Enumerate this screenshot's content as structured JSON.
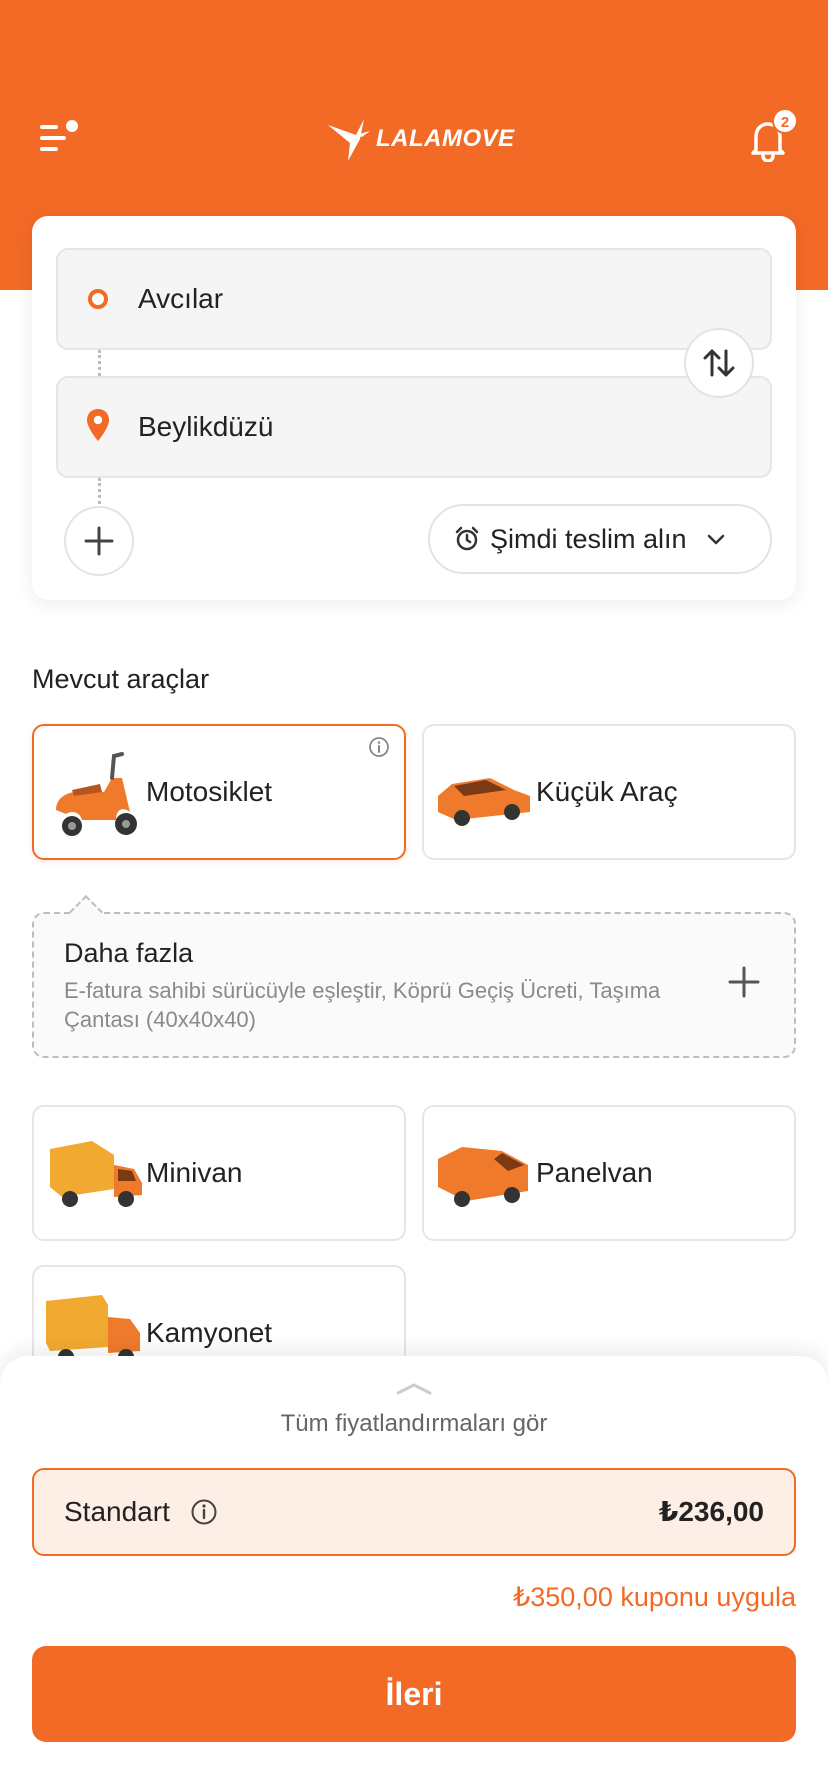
{
  "header": {
    "brand": "LALAMOVE",
    "notification_count": "2"
  },
  "route": {
    "pickup": "Avcılar",
    "dropoff": "Beylikdüzü",
    "schedule_label": "Şimdi teslim alın"
  },
  "vehicles": {
    "section_title": "Mevcut araçlar",
    "items": [
      {
        "label": "Motosiklet",
        "selected": true
      },
      {
        "label": "Küçük Araç",
        "selected": false
      },
      {
        "label": "Minivan",
        "selected": false
      },
      {
        "label": "Panelvan",
        "selected": false
      },
      {
        "label": "Kamyonet",
        "selected": false
      }
    ]
  },
  "more_options": {
    "title": "Daha fazla",
    "description": "E-fatura sahibi sürücüyle eşleştir, Köprü Geçiş Ücreti, Taşıma Çantası (40x40x40)"
  },
  "pricing": {
    "see_all_label": "Tüm fiyatlandırmaları gör",
    "tier_label": "Standart",
    "price": "₺236,00",
    "coupon_label": "₺350,00 kuponu uygula",
    "next_label": "İleri"
  },
  "colors": {
    "brand": "#f26a26",
    "selected_price_bg": "#fdeee6"
  }
}
